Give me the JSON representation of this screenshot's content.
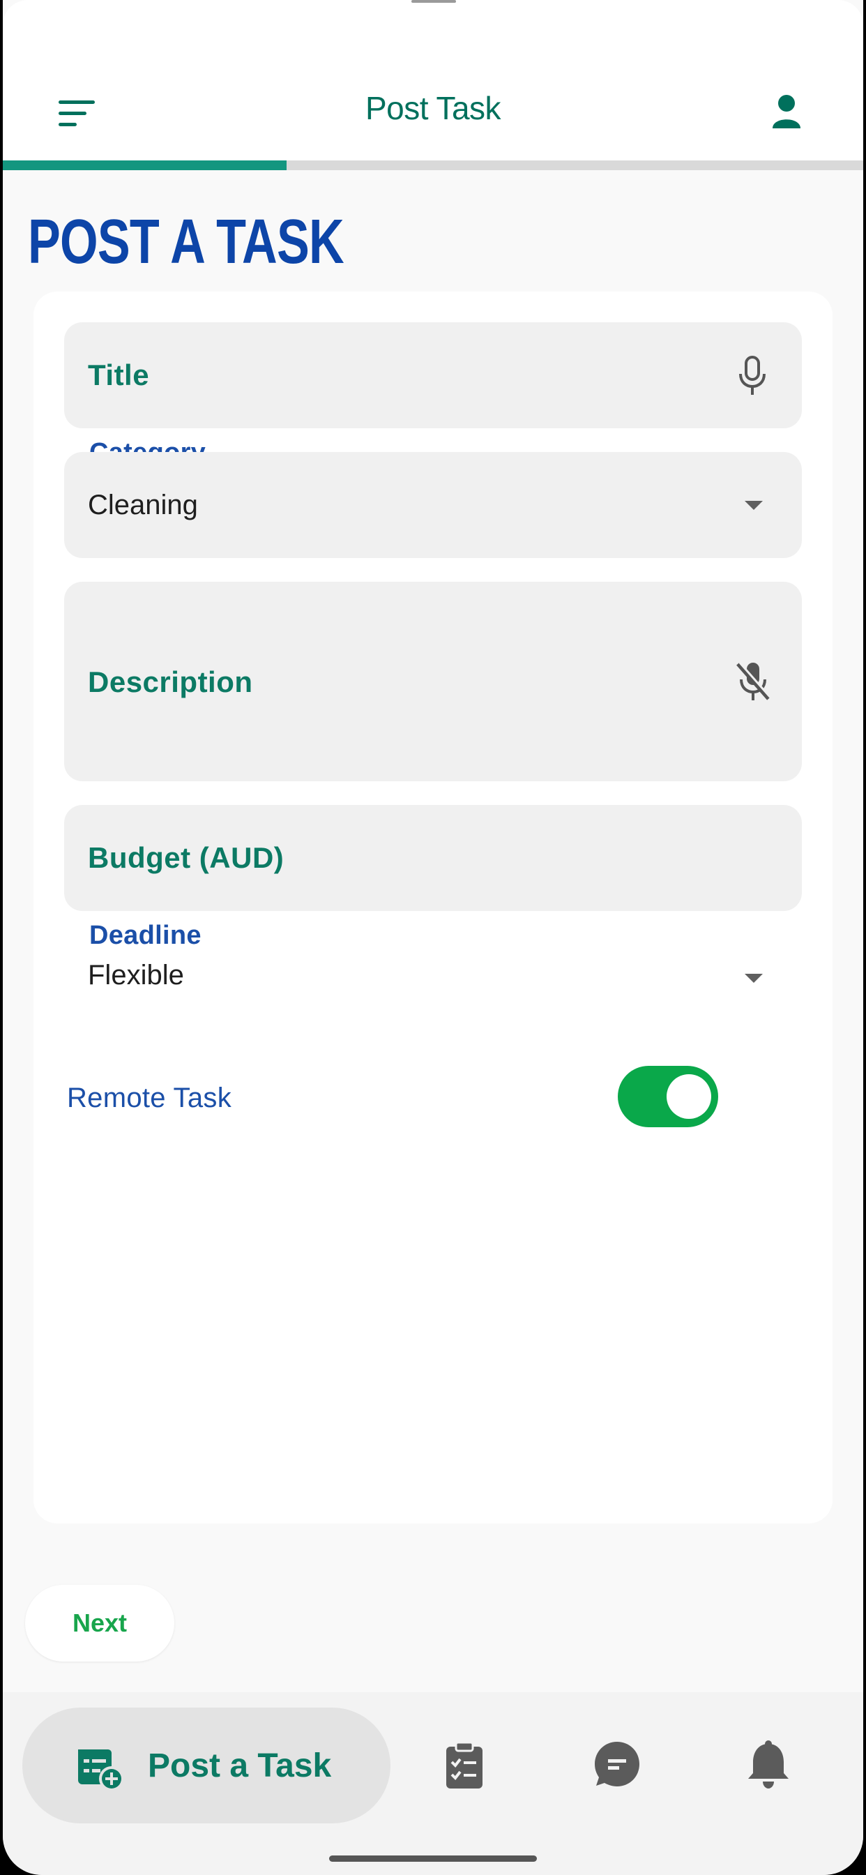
{
  "app_bar": {
    "title": "Post Task",
    "menu_icon": "menu-icon",
    "account_icon": "account-icon"
  },
  "progress": {
    "fraction": 0.33
  },
  "page": {
    "heading": "POST A TASK"
  },
  "form": {
    "title_label": "Title",
    "category_label": "Category",
    "category_value": "Cleaning",
    "description_label": "Description",
    "budget_label": "Budget (AUD)",
    "deadline_label": "Deadline",
    "deadline_value": "Flexible",
    "remote_label": "Remote Task",
    "remote_on": true
  },
  "actions": {
    "next_label": "Next"
  },
  "bottom_nav": {
    "active_label": "Post a Task",
    "items": [
      "post-task-icon",
      "tasks-clipboard-icon",
      "messages-icon",
      "notifications-bell-icon"
    ]
  },
  "colors": {
    "accent_green": "#00705c",
    "heading_blue": "#0d45a8",
    "toggle_green": "#0aa84a",
    "next_green": "#18a54c"
  }
}
